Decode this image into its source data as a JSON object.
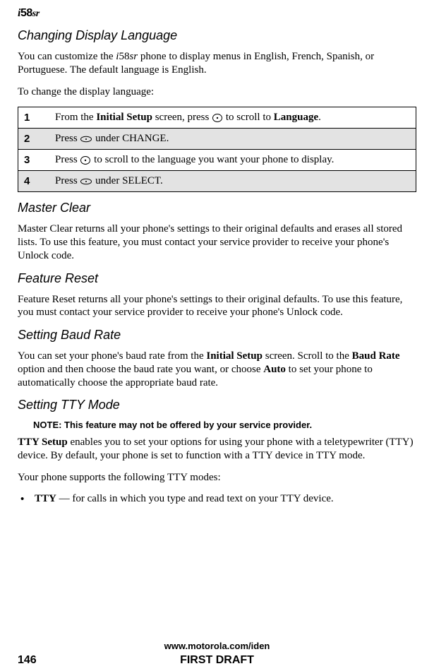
{
  "logo": {
    "i": "i",
    "num": "58",
    "sr": "sr"
  },
  "sections": {
    "changing_display_language": {
      "heading": "Changing Display Language",
      "p1_pre": "You can customize the ",
      "p1_model_i": "i",
      "p1_model_num": "58",
      "p1_model_sr": "sr",
      "p1_post": " phone to display menus in English, French, Spanish, or Portuguese. The default language is English.",
      "p2": "To change the display language:",
      "steps": [
        {
          "num": "1",
          "pre": "From the ",
          "b1": "Initial Setup",
          "mid": " screen, press ",
          "glyph": "R",
          "post1": " to scroll to ",
          "b2": "Language",
          "post2": "."
        },
        {
          "num": "2",
          "pre": "Press ",
          "glyph": "B",
          "post": " under CHANGE."
        },
        {
          "num": "3",
          "pre": "Press ",
          "glyph": "R",
          "post": " to scroll to the language you want your phone to display."
        },
        {
          "num": "4",
          "pre": "Press ",
          "glyph": "B",
          "post": " under SELECT."
        }
      ]
    },
    "master_clear": {
      "heading": "Master Clear",
      "p": "Master Clear returns all your phone's settings to their original defaults and erases all stored lists. To use this feature, you must contact your service provider to receive your phone's Unlock code."
    },
    "feature_reset": {
      "heading": "Feature Reset",
      "p": "Feature Reset returns all your phone's settings to their original defaults. To use this feature, you must contact your service provider to receive your phone's Unlock code."
    },
    "baud_rate": {
      "heading": "Setting Baud Rate",
      "pre": "You can set your phone's baud rate from the ",
      "b1": "Initial Setup",
      "mid1": " screen. Scroll to the ",
      "b2": "Baud Rate",
      "mid2": " option and then choose the baud rate you want, or choose ",
      "b3": "Auto",
      "post": " to set your phone to automatically choose the appropriate baud rate."
    },
    "tty_mode": {
      "heading": "Setting TTY Mode",
      "note": "NOTE: This feature may not be offered by your service provider.",
      "p1_b": "TTY Setup",
      "p1_post": " enables you to set your options for using your phone with a teletypewriter (TTY) device. By default, your phone is set to function with a TTY device in TTY mode.",
      "p2": "Your phone supports the following TTY modes:",
      "bullet_b": "TTY",
      "bullet_post": " — for calls in which you type and read text on your TTY device."
    }
  },
  "footer": {
    "url": "www.motorola.com/iden",
    "page_num": "146",
    "draft": "FIRST DRAFT"
  }
}
